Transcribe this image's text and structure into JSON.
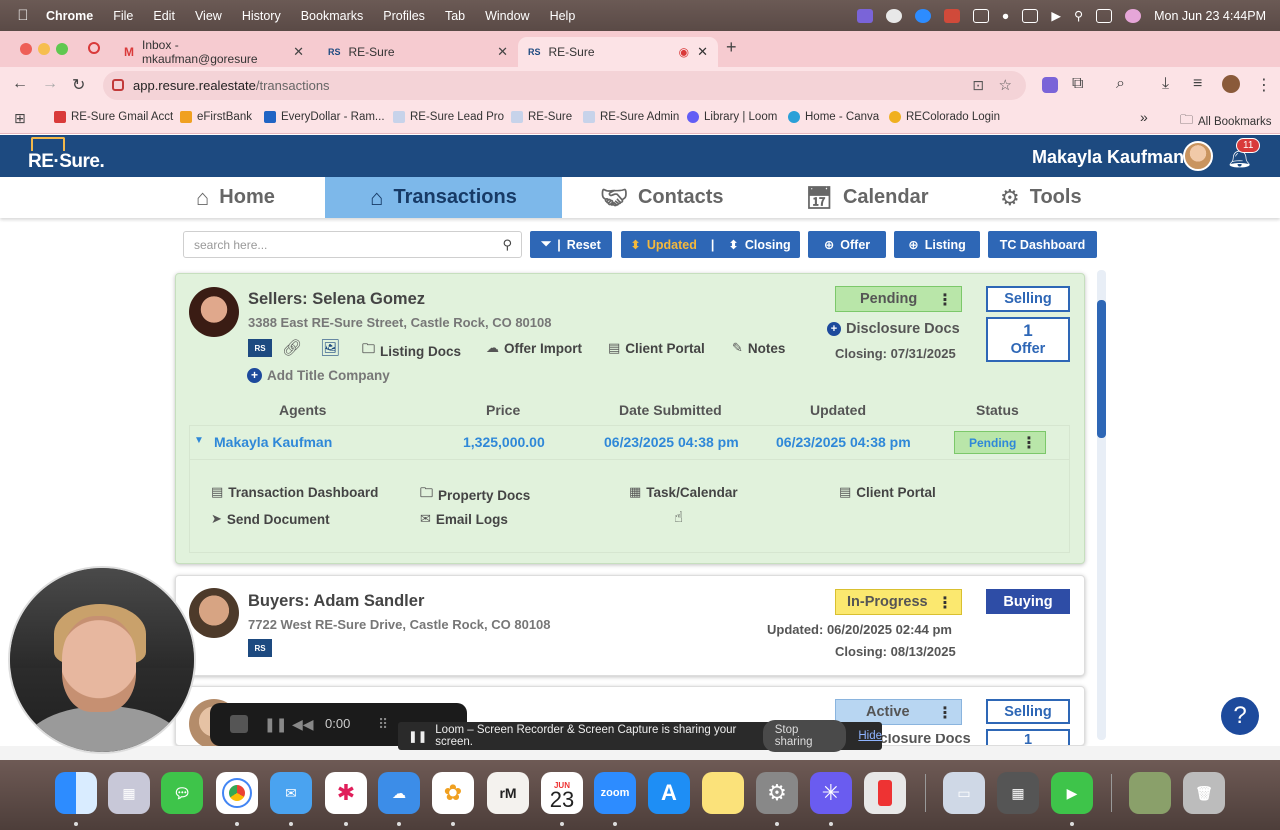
{
  "os": {
    "menubar": {
      "app": "Chrome",
      "items": [
        "File",
        "Edit",
        "View",
        "History",
        "Bookmarks",
        "Profiles",
        "Tab",
        "Window",
        "Help"
      ],
      "datetime": "Mon Jun 23  4:44PM"
    }
  },
  "browser": {
    "tabs": [
      {
        "label": "Inbox - mkaufman@goresure"
      },
      {
        "label": "RE-Sure"
      },
      {
        "label": "RE-Sure"
      }
    ],
    "url": {
      "host": "app.resure.realestate",
      "path": "/transactions"
    },
    "bookmarks": [
      {
        "label": "RE-Sure Gmail Acct"
      },
      {
        "label": "eFirstBank"
      },
      {
        "label": "EveryDollar - Ram..."
      },
      {
        "label": "RE-Sure Lead Pro"
      },
      {
        "label": "RE-Sure"
      },
      {
        "label": "RE-Sure Admin"
      },
      {
        "label": "Library | Loom"
      },
      {
        "label": "Home - Canva"
      },
      {
        "label": "REColorado Login"
      }
    ],
    "all_bookmarks": "All Bookmarks"
  },
  "app": {
    "logo_text": "RE·Sure.",
    "user_name": "Makayla Kaufman",
    "notification_count": "11",
    "nav": [
      {
        "label": "Home"
      },
      {
        "label": "Transactions"
      },
      {
        "label": "Contacts"
      },
      {
        "label": "Calendar"
      },
      {
        "label": "Tools"
      }
    ],
    "toolbar": {
      "search_placeholder": "search here...",
      "reset": "Reset",
      "updated": "Updated",
      "closing": "Closing",
      "offer": "Offer",
      "listing": "Listing",
      "tc_dashboard": "TC Dashboard"
    },
    "cards": [
      {
        "title": "Sellers: Selena Gomez",
        "address": "3388 East RE-Sure Street, Castle Rock, CO 80108",
        "links": [
          "Listing Docs",
          "Offer Import",
          "Client Portal",
          "Notes"
        ],
        "add_title": "Add Title Company",
        "status": "Pending",
        "disclosure": "Disclosure Docs",
        "closing": "Closing: 07/31/2025",
        "side_type": "Selling",
        "offer_count": "1",
        "offer_label": "Offer",
        "table_headers": [
          "Agents",
          "Price",
          "Date Submitted",
          "Updated",
          "Status"
        ],
        "offer_row": {
          "agent": "Makayla Kaufman",
          "price": "1,325,000.00",
          "date_submitted": "06/23/2025 04:38 pm",
          "updated": "06/23/2025 04:38 pm",
          "status": "Pending"
        },
        "offer_actions": [
          "Transaction Dashboard",
          "Property Docs",
          "Task/Calendar",
          "Client Portal",
          "Send Document",
          "Email Logs"
        ]
      },
      {
        "title": "Buyers: Adam Sandler",
        "address": "7722 West RE-Sure Drive, Castle Rock, CO 80108",
        "status": "In-Progress",
        "updated": "Updated: 06/20/2025 02:44 pm",
        "closing": "Closing: 08/13/2025",
        "side_type": "Buying"
      },
      {
        "status": "Active",
        "disclosure": "Disclosure Docs",
        "side_type": "Selling",
        "offer_count": "1"
      }
    ],
    "help": "?"
  },
  "loom": {
    "timer": "0:00",
    "banner": "Loom – Screen Recorder & Screen Capture is sharing your screen.",
    "stop": "Stop sharing",
    "hide": "Hide"
  },
  "dock": {
    "calendar_month": "JUN",
    "calendar_day": "23",
    "zoom": "zoom",
    "rm": "rM"
  },
  "colors": {
    "header_blue": "#1d4a80",
    "nav_active": "#7db8ea",
    "button_blue": "#2e67b6",
    "card_green": "#e1f2dc",
    "pending_green": "#b9e6a9",
    "in_progress_yellow": "#fbe86f",
    "active_blue": "#b8d6f2",
    "link_blue": "#2f88d8"
  }
}
